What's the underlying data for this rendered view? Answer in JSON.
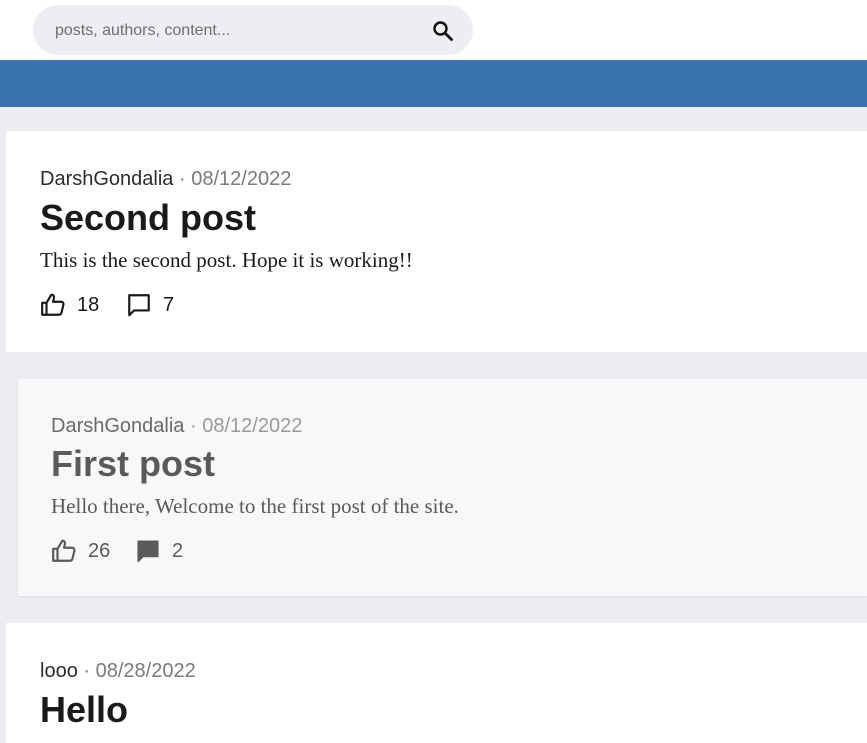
{
  "search": {
    "placeholder": "posts, authors, content..."
  },
  "posts": [
    {
      "author": "DarshGondalia",
      "separator": "·",
      "date": "08/12/2022",
      "title": "Second post",
      "body": "This is the second post. Hope it is working!!",
      "likes": "18",
      "comments": "7",
      "comment_icon": "comment-outline-icon"
    },
    {
      "author": "DarshGondalia",
      "separator": "·",
      "date": "08/12/2022",
      "title": "First post",
      "body": "Hello there, Welcome to the first post of the site.",
      "likes": "26",
      "comments": "2",
      "comment_icon": "comment-filled-icon"
    },
    {
      "author": "looo",
      "separator": "·",
      "date": "08/28/2022",
      "title": "Hello"
    }
  ],
  "colors": {
    "accent_bar": "#3a72b0",
    "page_background": "#ebedf1",
    "search_background": "#edeef1"
  }
}
